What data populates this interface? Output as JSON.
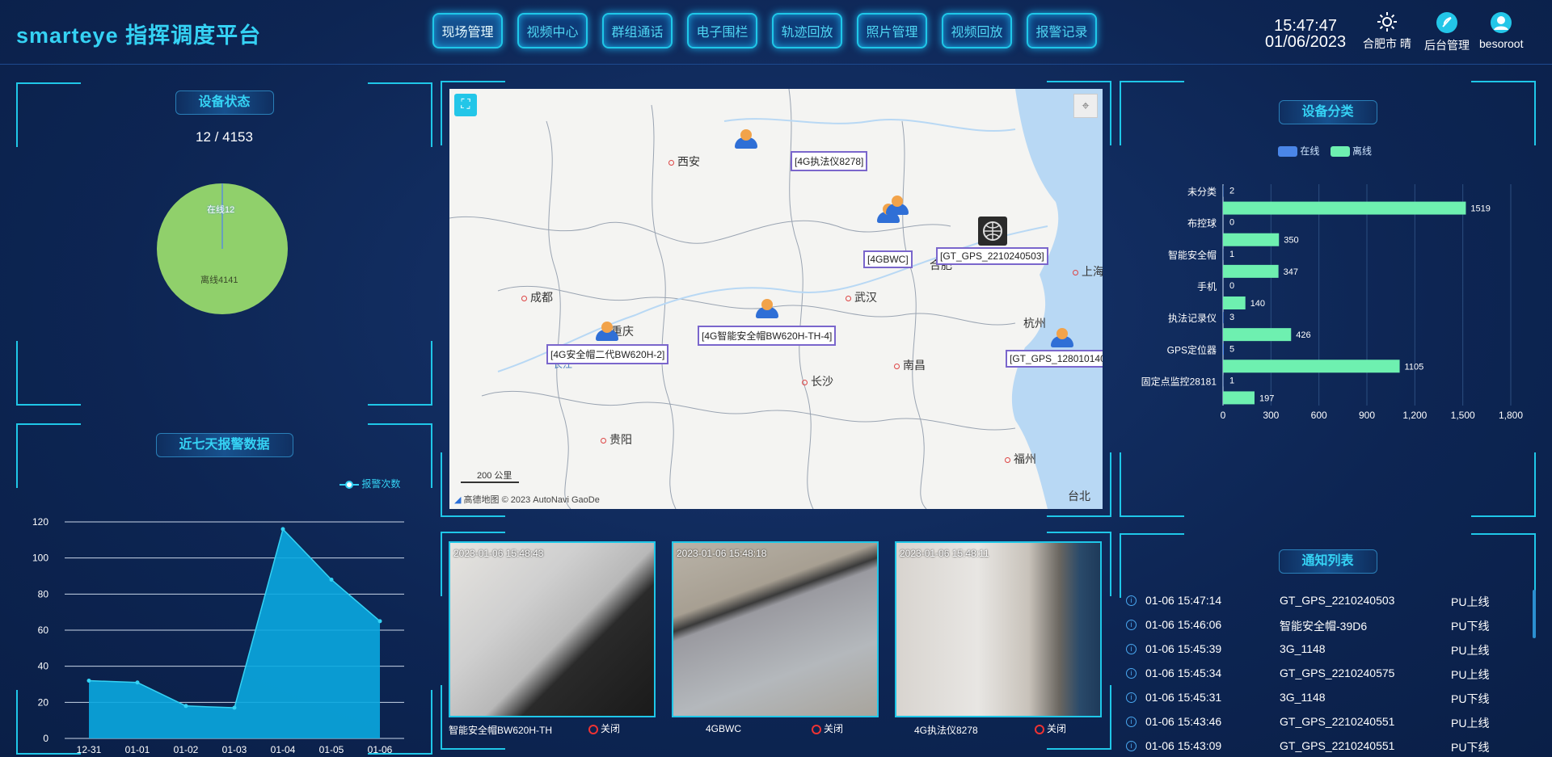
{
  "header": {
    "title": "smarteye 指挥调度平台",
    "nav": [
      "现场管理",
      "视频中心",
      "群组通话",
      "电子围栏",
      "轨迹回放",
      "照片管理",
      "视频回放",
      "报警记录"
    ],
    "time": "15:47:47",
    "date": "01/06/2023",
    "weather": "合肥市 晴",
    "admin_label": "后台管理",
    "user": "besoroot"
  },
  "device_status": {
    "title": "设备状态",
    "count": "12 / 4153",
    "online_label": "在线12",
    "offline_label": "离线4141",
    "online": 12,
    "offline": 4141
  },
  "alarm_chart": {
    "title": "近七天报警数据",
    "legend": "报警次数",
    "chart_data": {
      "type": "area",
      "x": [
        "12-31",
        "01-01",
        "01-02",
        "01-03",
        "01-04",
        "01-05",
        "01-06"
      ],
      "series": [
        {
          "name": "报警次数",
          "values": [
            32,
            31,
            18,
            17,
            116,
            88,
            65
          ]
        }
      ],
      "ylim": [
        0,
        120
      ],
      "yticks": [
        0,
        20,
        40,
        60,
        80,
        100,
        120
      ]
    }
  },
  "map": {
    "cities": [
      "西安",
      "成都",
      "重庆",
      "武汉",
      "合肥",
      "上海",
      "杭州",
      "南昌",
      "长沙",
      "贵阳",
      "福州",
      "台北",
      "长江"
    ],
    "labels": [
      "[4G执法仪8278]",
      "[4GBWC]",
      "[GT_GPS_2210240503]",
      "[4G智能安全帽BW620H-TH-4]",
      "[4G安全帽二代BW620H-2]",
      "[GT_GPS_128010140"
    ],
    "scale": "200 公里",
    "copyright": "高德地图 © 2023 AutoNavi GaoDe"
  },
  "videos": [
    {
      "timestamp": "2023-01-06 15:48:43",
      "caption": "智能安全帽BW620H-TH",
      "close": "关闭"
    },
    {
      "timestamp": "2023-01-06 15:48:18",
      "caption": "4GBWC",
      "close": "关闭"
    },
    {
      "timestamp": "2023-01-06 15:48:11",
      "caption": "4G执法仪8278",
      "close": "关闭"
    }
  ],
  "device_category": {
    "title": "设备分类",
    "legend_online": "在线",
    "legend_offline": "离线",
    "chart_data": {
      "type": "bar",
      "orientation": "horizontal",
      "categories": [
        "未分类",
        "布控球",
        "智能安全帽",
        "手机",
        "执法记录仪",
        "GPS定位器",
        "固定点监控28181"
      ],
      "series": [
        {
          "name": "在线",
          "values": [
            2,
            0,
            1,
            0,
            3,
            5,
            1
          ]
        },
        {
          "name": "离线",
          "values": [
            1519,
            350,
            347,
            140,
            426,
            1105,
            197
          ]
        }
      ],
      "xlim": [
        0,
        1800
      ],
      "xticks": [
        "0",
        "300",
        "600",
        "900",
        "1,200",
        "1,500",
        "1,800"
      ]
    }
  },
  "notices": {
    "title": "通知列表",
    "rows": [
      {
        "time": "01-06 15:47:14",
        "name": "GT_GPS_2210240503",
        "status": "PU上线"
      },
      {
        "time": "01-06 15:46:06",
        "name": "智能安全帽-39D6",
        "status": "PU下线"
      },
      {
        "time": "01-06 15:45:39",
        "name": "3G_1148",
        "status": "PU上线"
      },
      {
        "time": "01-06 15:45:34",
        "name": "GT_GPS_2210240575",
        "status": "PU上线"
      },
      {
        "time": "01-06 15:45:31",
        "name": "3G_1148",
        "status": "PU下线"
      },
      {
        "time": "01-06 15:43:46",
        "name": "GT_GPS_2210240551",
        "status": "PU上线"
      },
      {
        "time": "01-06 15:43:09",
        "name": "GT_GPS_2210240551",
        "status": "PU下线"
      }
    ]
  },
  "colors": {
    "accent": "#1fc7e8",
    "online": "#4a86e8",
    "offline": "#6ef0b0",
    "pie": "#90d06b",
    "area": "#0aa8e0"
  }
}
